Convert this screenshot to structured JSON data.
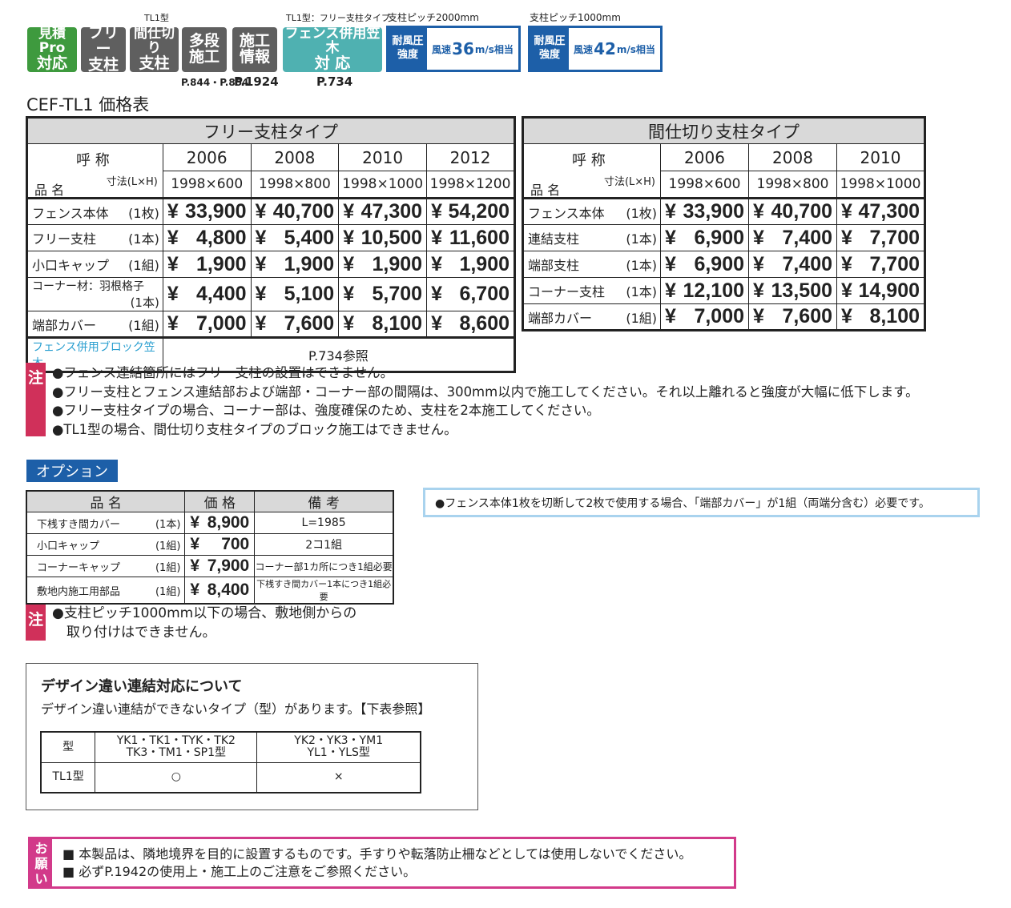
{
  "badges": {
    "mitsumori": [
      "見積Pro",
      "対応"
    ],
    "free_post": [
      "フリー",
      "支柱"
    ],
    "partition_post": [
      "間仕切り",
      "支柱"
    ],
    "multistage": [
      "多段",
      "施工"
    ],
    "construction": [
      "施工",
      "情報"
    ],
    "fence_kasagi": [
      "フェンス併用笠木",
      "対 応"
    ],
    "tl1_label": "TL1型",
    "tl1_free_label": "TL1型：フリー支柱タイプ",
    "pitch2000": "支柱ピッチ2000mm",
    "pitch1000": "支柱ピッチ1000mm",
    "wind_label": [
      "耐風圧",
      "強度"
    ],
    "wind36": {
      "pre": "風速",
      "num": "36",
      "post": "m/s相当"
    },
    "wind42": {
      "pre": "風速",
      "num": "42",
      "post": "m/s相当"
    },
    "ref_multistage": "P.844・P.854",
    "ref_construction": "P.1924",
    "ref_kasagi": "P.734"
  },
  "page_title": "CEF-TL1 価格表",
  "header_labels": {
    "yobishou": "呼 称",
    "sunpou": "寸法(L×H)",
    "hinmei": "品 名"
  },
  "free_table": {
    "title": "フリー支柱タイプ",
    "codes": [
      "2006",
      "2008",
      "2010",
      "2012"
    ],
    "dims": [
      "1998×600",
      "1998×800",
      "1998×1000",
      "1998×1200"
    ],
    "rows": [
      {
        "name": "フェンス本体",
        "qty": "(1枚)",
        "prices": [
          "33,900",
          "40,700",
          "47,300",
          "54,200"
        ]
      },
      {
        "name": "フリー支柱",
        "qty": "(1本)",
        "prices": [
          "4,800",
          "5,400",
          "10,500",
          "11,600"
        ]
      },
      {
        "name": "小口キャップ",
        "qty": "(1組)",
        "prices": [
          "1,900",
          "1,900",
          "1,900",
          "1,900"
        ]
      },
      {
        "name": "コーナー材：羽根格子",
        "qty": "(1本)",
        "prices": [
          "4,400",
          "5,100",
          "5,700",
          "6,700"
        ]
      },
      {
        "name": "端部カバー",
        "qty": "(1組)",
        "prices": [
          "7,000",
          "7,600",
          "8,100",
          "8,600"
        ]
      }
    ],
    "kasagi_name": "フェンス併用ブロック笠木",
    "kasagi_ref": "P.734参照"
  },
  "partition_table": {
    "title": "間仕切り支柱タイプ",
    "codes": [
      "2006",
      "2008",
      "2010"
    ],
    "dims": [
      "1998×600",
      "1998×800",
      "1998×1000"
    ],
    "rows": [
      {
        "name": "フェンス本体",
        "qty": "(1枚)",
        "prices": [
          "33,900",
          "40,700",
          "47,300"
        ]
      },
      {
        "name": "連結支柱",
        "qty": "(1本)",
        "prices": [
          "6,900",
          "7,400",
          "7,700"
        ]
      },
      {
        "name": "端部支柱",
        "qty": "(1本)",
        "prices": [
          "6,900",
          "7,400",
          "7,700"
        ]
      },
      {
        "name": "コーナー支柱",
        "qty": "(1本)",
        "prices": [
          "12,100",
          "13,500",
          "14,900"
        ]
      },
      {
        "name": "端部カバー",
        "qty": "(1組)",
        "prices": [
          "7,000",
          "7,600",
          "8,100"
        ]
      }
    ]
  },
  "yen": "¥",
  "chu": "注",
  "notes": [
    "●フェンス連結箇所にはフリー支柱の設置はできません。",
    "●フリー支柱とフェンス連結部および端部・コーナー部の間隔は、300mm以内で施工してください。それ以上離れると強度が大幅に低下します。",
    "●フリー支柱タイプの場合、コーナー部は、強度確保のため、支柱を2本施工してください。",
    "●TL1型の場合、間仕切り支柱タイプのブロック施工はできません。"
  ],
  "option": {
    "heading": "オプション",
    "headers": [
      "品 名",
      "価 格",
      "備 考"
    ],
    "rows": [
      {
        "name": "下桟すき間カバー",
        "qty": "(1本)",
        "price": "8,900",
        "remark": "L=1985"
      },
      {
        "name": "小口キャップ",
        "qty": "(1組)",
        "price": "700",
        "remark": "2コ1組"
      },
      {
        "name": "コーナーキャップ",
        "qty": "(1組)",
        "price": "7,900",
        "remark": "コーナー部1カ所につき1組必要"
      },
      {
        "name": "敷地内施工用部品",
        "qty": "(1組)",
        "price": "8,400",
        "remark": "下桟すき間カバー1本につき1組必要"
      }
    ],
    "note": [
      "●支柱ピッチ1000mm以下の場合、敷地側からの",
      "取り付けはできません。"
    ],
    "side_note": "●フェンス本体1枚を切断して2枚で使用する場合、「端部カバー」が1組（両端分含む）必要です。"
  },
  "design": {
    "title": "デザイン違い連結対応について",
    "subtitle": "デザイン違い連結ができないタイプ（型）があります。【下表参照】",
    "col0": "型",
    "col1": [
      "YK1・TK1・TYK・TK2",
      "TK3・TM1・SP1型"
    ],
    "col2": [
      "YK2・YK3・YM1",
      "YL1・YLS型"
    ],
    "row_label": "TL1型",
    "v1": "○",
    "v2": "×"
  },
  "onegai": {
    "label": [
      "お",
      "願",
      "い"
    ],
    "lines": [
      "■ 本製品は、隣地境界を目的に設置するものです。手すりや転落防止柵などとしては使用しないでください。",
      "■ 必ずP.1942の使用上・施工上のご注意をご参照ください。"
    ]
  }
}
